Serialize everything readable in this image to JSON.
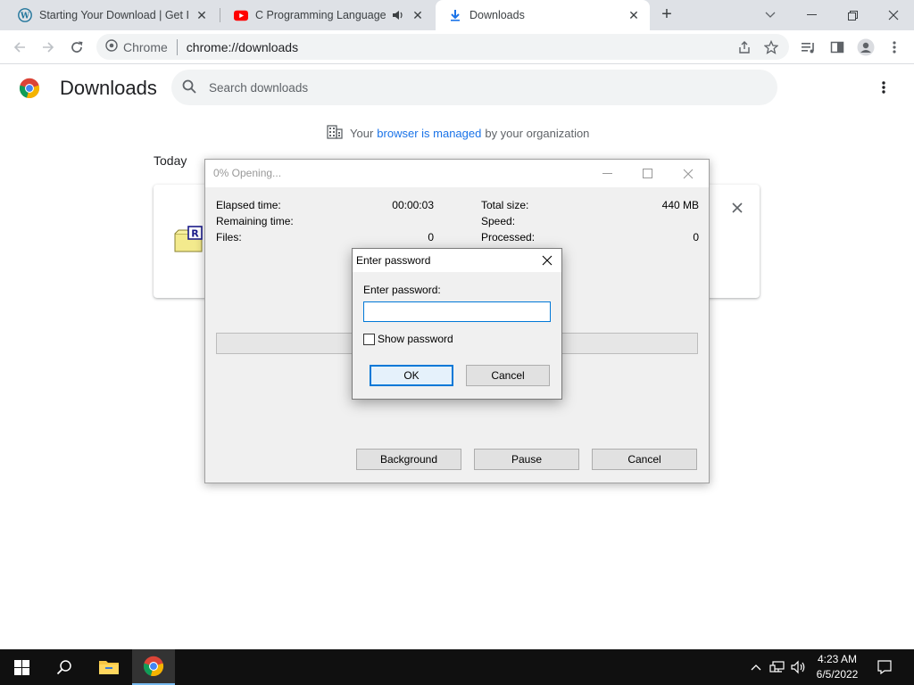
{
  "browser": {
    "tabs": [
      {
        "title": "Starting Your Download | Get Into",
        "icon": "wordpress-icon",
        "active": false
      },
      {
        "title": "C Programming Language -",
        "icon": "youtube-icon",
        "active": false
      },
      {
        "title": "Downloads",
        "icon": "download-icon",
        "active": true
      }
    ],
    "omnibox": {
      "site": "Chrome",
      "url": "chrome://downloads"
    }
  },
  "downloads": {
    "title": "Downloads",
    "search_placeholder": "Search downloads",
    "managed_prefix": "Your",
    "managed_link": "browser is managed",
    "managed_suffix": "by your organization",
    "section": "Today"
  },
  "progress_window": {
    "title": "0% Opening...",
    "progress_percent": 0,
    "left": [
      {
        "label": "Elapsed time:",
        "value": "00:00:03"
      },
      {
        "label": "Remaining time:",
        "value": ""
      },
      {
        "label": "Files:",
        "value": "0"
      }
    ],
    "right": [
      {
        "label": "Total size:",
        "value": "440 MB"
      },
      {
        "label": "Speed:",
        "value": ""
      },
      {
        "label": "Processed:",
        "value": "0"
      }
    ],
    "buttons": {
      "background": "Background",
      "pause": "Pause",
      "cancel": "Cancel"
    }
  },
  "password_dialog": {
    "title": "Enter password",
    "label": "Enter password:",
    "value": "",
    "show_password": "Show password",
    "ok": "OK",
    "cancel": "Cancel"
  },
  "taskbar": {
    "time": "4:23 AM",
    "date": "6/5/2022"
  },
  "colors": {
    "accent": "#0078d7",
    "chrome_link": "#1a73e8",
    "taskbar": "#101010"
  }
}
